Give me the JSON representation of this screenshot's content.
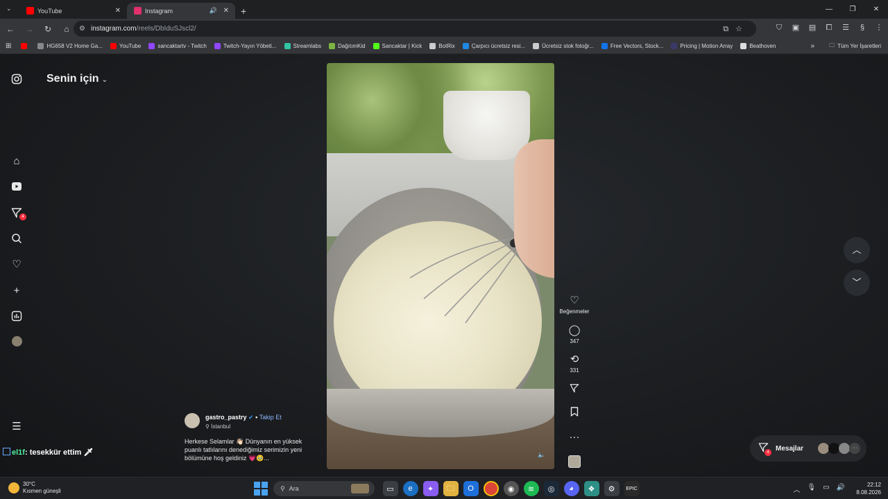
{
  "browser": {
    "tabs": [
      {
        "title": "YouTube",
        "icon": "youtube-icon",
        "color": "#ff0000"
      },
      {
        "title": "Instagram",
        "icon": "instagram-icon",
        "color": "#e1306c",
        "active": true
      }
    ],
    "url_host": "instagram.com",
    "url_path": "/reels/DbIduSJscl2/",
    "bookmarks": [
      {
        "label": "",
        "icon": "youtube-icon",
        "color": "#ff0000"
      },
      {
        "label": "HG658 V2 Home Ga...",
        "icon": "globe-icon",
        "color": "#888888"
      },
      {
        "label": "YouTube",
        "icon": "youtube-icon",
        "color": "#ff0000"
      },
      {
        "label": "sancaktartv - Twitch",
        "icon": "twitch-icon",
        "color": "#9146ff"
      },
      {
        "label": "Twitch-Yayın Yöbeti...",
        "icon": "twitch-icon",
        "color": "#9146ff"
      },
      {
        "label": "Streamlabs",
        "icon": "streamlabs-icon",
        "color": "#31c3a2"
      },
      {
        "label": "DağıtımKid",
        "icon": "dagitim-icon",
        "color": "#7cb342"
      },
      {
        "label": "Sancaktar | Kick",
        "icon": "kick-icon",
        "color": "#53fc18"
      },
      {
        "label": "BotRix",
        "icon": "botrix-icon",
        "color": "#cccccc"
      },
      {
        "label": "Çarpıcı ücretsiz resi...",
        "icon": "px-icon",
        "color": "#1e88e5"
      },
      {
        "label": "Ücretsiz stok fotoğr...",
        "icon": "pexels-icon",
        "color": "#cccccc"
      },
      {
        "label": "Free Vectors, Stock...",
        "icon": "freepik-icon",
        "color": "#1273eb"
      },
      {
        "label": "Pricing | Motion Array",
        "icon": "motionarray-icon",
        "color": "#3a3a6a"
      },
      {
        "label": "Beathoven",
        "icon": "beathoven-icon",
        "color": "#dddddd"
      }
    ],
    "all_bookmarks": "Tüm Yer İşaretleri"
  },
  "instagram": {
    "feed_title": "Senin için",
    "dm_badge": "4",
    "actions": {
      "like_label": "Beğenmeler",
      "comments": "347",
      "reposts": "331"
    },
    "author": {
      "username": "gastro_pastry",
      "verified_mark": "✔",
      "separator": "•",
      "follow": "Takip Et",
      "location": "İstanbul"
    },
    "caption": "Herkese Selamlar 👋🏻 Dünyanın en yüksek puanlı tatlılarını denediğimiz serimizin yeni bölümüne hoş geldiniz 💗🥹...",
    "messages_label": "Mesajlar",
    "messages_badge": "4"
  },
  "overlay": {
    "chat_name": "el1f",
    "chat_text": ": tesekkür ettim"
  },
  "taskbar": {
    "weather_temp": "30°C",
    "weather_desc": "Kısmen güneşli",
    "search_placeholder": "Ara",
    "time": "22:12",
    "date": "8.08.2026"
  }
}
